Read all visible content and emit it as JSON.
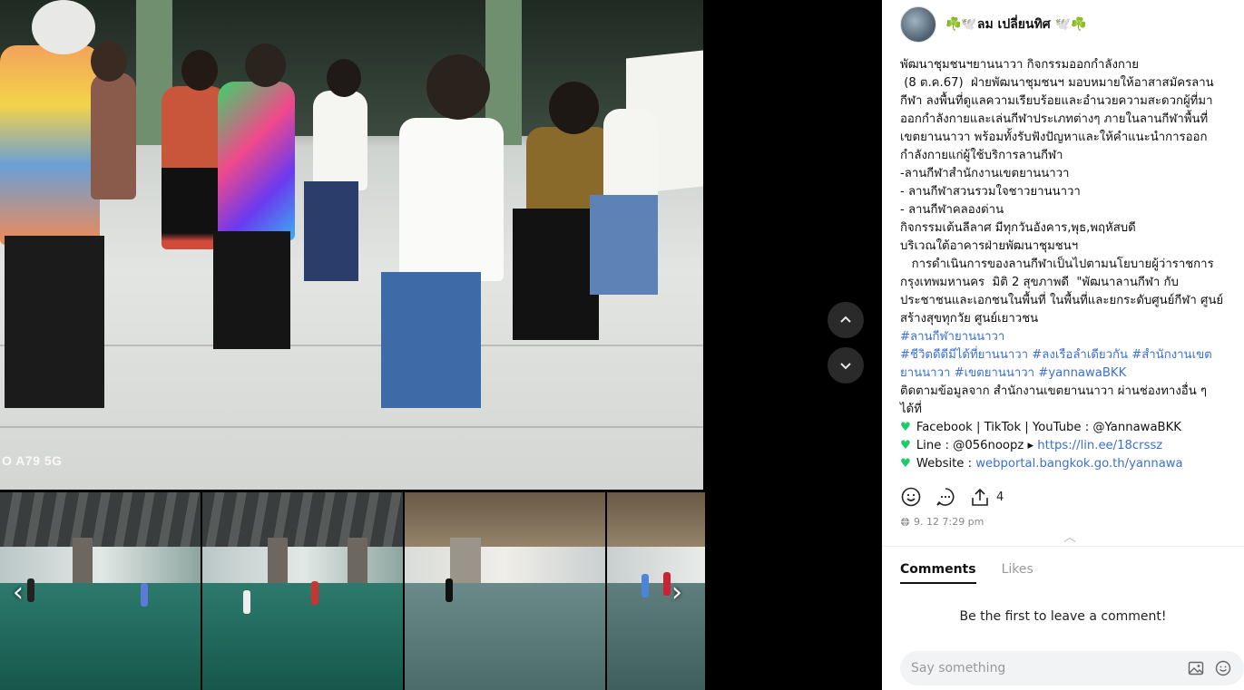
{
  "author": {
    "name": "☘️🕊️ลม เปลี่ยนทิศ 🕊️☘️"
  },
  "post": {
    "lines": [
      "พัฒนาชุมชนฯยานนาวา กิจกรรมออกกำลังกาย",
      " (8 ต.ค.67)  ฝ่ายพัฒนาชุมชนฯ มอบหมายให้อาสาสมัครลาน",
      "กีฬา ลงพื้นที่ดูแลความเรียบร้อยและอำนวยความสะดวกผู้ที่มา",
      "ออกกำลังกายและเล่นกีฬาประเภทต่างๆ ภายในลานกีฬาพื้นที่",
      "เขตยานนาวา พร้อมทั้งรับฟังปัญหาและให้คำแนะนำการออก",
      "กำลังกายแก่ผู้ใช้บริการลานกีฬา",
      "-ลานกีฬาสำนักงานเขตยานนาวา",
      "- ลานกีฬาสวนรวมใจชาวยานนาวา",
      "- ลานกีฬาคลองด่าน",
      "กิจกรรมเต้นลีลาศ มีทุกวันอังคาร,พุธ,พฤหัสบดี",
      "บริเวณใต้อาคารฝ่ายพัฒนาชุมชนฯ",
      "   การดำเนินการของลานกีฬาเป็นไปตามนโยบายผู้ว่าราชการ",
      "กรุงเทพมหานคร  มิติ 2 สุขภาพดี  \"พัฒนาลานกีฬา กับ",
      "ประชาชนและเอกชนในพื้นที่ ในพื้นที่และยกระดับศูนย์กีฬา ศูนย์",
      "สร้างสุขทุกวัย ศูนย์เยาวชน"
    ],
    "hashtag_line1": "#ลานกีฬายานนาวา",
    "hashtag_line2": "#ชีวิตดีดีมีได้ที่ยานนาวา #ลงเรือลำเดียวกัน #สำนักงานเขต",
    "hashtag_line3": "ยานนาวา #เขตยานนาวา #yannawaBKK",
    "follow_line1": "ติดตามข้อมูลจาก สำนักงานเขตยานนาวา ผ่านช่องทางอื่น ๆ",
    "follow_line2": "ได้ที่",
    "social_label": "Facebook | TikTok | YouTube : @YannawaBKK",
    "line_label": "Line : @056noopz ",
    "line_link": "https://lin.ee/18crssz",
    "website_label": "Website : ",
    "website_link": "webportal.bangkok.go.th/yannawa"
  },
  "actions": {
    "share_count": "4"
  },
  "meta": {
    "timestamp": "9. 12 7:29 pm"
  },
  "tabs": {
    "comments": "Comments",
    "likes": "Likes"
  },
  "empty_state": "Be the first to leave a comment!",
  "composer": {
    "placeholder": "Say something"
  },
  "media": {
    "watermark": "O A79 5G"
  },
  "colors": {
    "link": "#3b6fd8",
    "heart": "#1ec96b",
    "panel_bg": "#ffffff"
  }
}
